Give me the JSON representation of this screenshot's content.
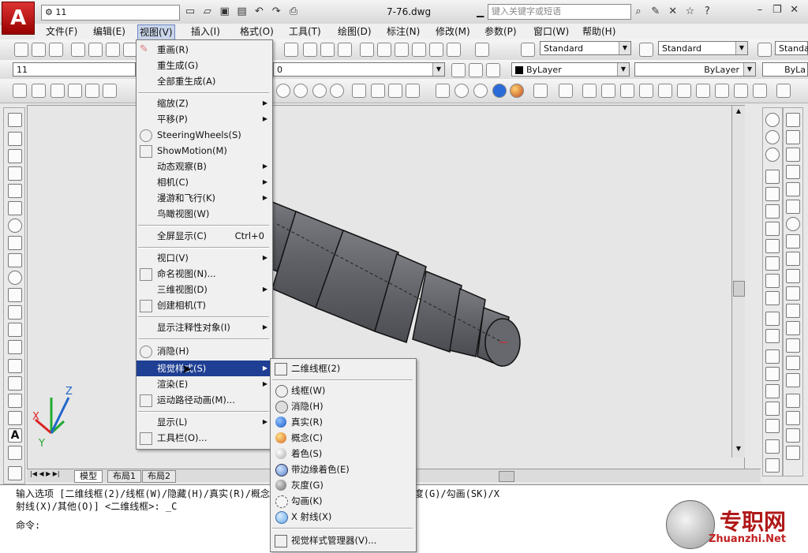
{
  "title_bar": {
    "workspace_value": "11",
    "file_title": "7-76.dwg",
    "search_placeholder": "键入关键字或短语"
  },
  "menubar": {
    "items": [
      "文件(F)",
      "编辑(E)",
      "视图(V)",
      "插入(I)",
      "格式(O)",
      "工具(T)",
      "绘图(D)",
      "标注(N)",
      "修改(M)",
      "参数(P)",
      "窗口(W)",
      "帮助(H)"
    ]
  },
  "toolbars": {
    "text_style": "Standard",
    "dim_style": "Standard",
    "table_style": "Standa",
    "layer_value": "11",
    "layer_state": "0",
    "color": "ByLayer",
    "linetype": "ByLayer",
    "lineweight": "ByLa"
  },
  "view_menu": {
    "items": [
      {
        "label": "重画(R)",
        "icon": "pencil-icon"
      },
      {
        "label": "重生成(G)"
      },
      {
        "label": "全部重生成(A)"
      },
      {
        "label": "缩放(Z)",
        "submenu": true
      },
      {
        "label": "平移(P)",
        "submenu": true
      },
      {
        "label": "SteeringWheels(S)",
        "icon": "steering-wheel-icon"
      },
      {
        "label": "ShowMotion(M)",
        "icon": "showmotion-icon"
      },
      {
        "label": "动态观察(B)",
        "submenu": true
      },
      {
        "label": "相机(C)",
        "submenu": true
      },
      {
        "label": "漫游和飞行(K)",
        "submenu": true
      },
      {
        "label": "鸟瞰视图(W)"
      },
      {
        "label": "全屏显示(C)",
        "shortcut": "Ctrl+0"
      },
      {
        "label": "视口(V)",
        "submenu": true
      },
      {
        "label": "命名视图(N)...",
        "icon": "named-view-icon"
      },
      {
        "label": "三维视图(D)",
        "submenu": true
      },
      {
        "label": "创建相机(T)",
        "icon": "camera-icon"
      },
      {
        "label": "显示注释性对象(I)",
        "submenu": true
      },
      {
        "label": "消隐(H)",
        "icon": "hide-icon"
      },
      {
        "label": "视觉样式(S)",
        "submenu": true
      },
      {
        "label": "渲染(E)",
        "submenu": true
      },
      {
        "label": "运动路径动画(M)...",
        "icon": "motion-path-icon"
      },
      {
        "label": "显示(L)",
        "submenu": true
      },
      {
        "label": "工具栏(O)...",
        "icon": "toolbar-icon"
      }
    ]
  },
  "visual_styles_menu": {
    "items": [
      {
        "label": "二维线框(2)"
      },
      {
        "label": "线框(W)"
      },
      {
        "label": "消隐(H)"
      },
      {
        "label": "真实(R)"
      },
      {
        "label": "概念(C)"
      },
      {
        "label": "着色(S)"
      },
      {
        "label": "带边缘着色(E)"
      },
      {
        "label": "灰度(G)"
      },
      {
        "label": "勾画(K)"
      },
      {
        "label": "X 射线(X)"
      },
      {
        "label": "视觉样式管理器(V)..."
      }
    ]
  },
  "tabs": [
    "模型",
    "布局1",
    "布局2"
  ],
  "command": {
    "line1": "输入选项 [二维线框(2)/线框(W)/隐藏(H)/真实(R)/概念(C)/着色(S)/带边缘着色(E)/灰度(G)/勾画(SK)/X",
    "line2": "射线(X)/其他(O)] <二维线框>: _C",
    "prompt": "命令:"
  },
  "watermark": {
    "text_cn": "专职网",
    "text_en": "Zhuanzhi.Net"
  },
  "ucs": {
    "x": "X",
    "y": "Y",
    "z": "Z"
  }
}
